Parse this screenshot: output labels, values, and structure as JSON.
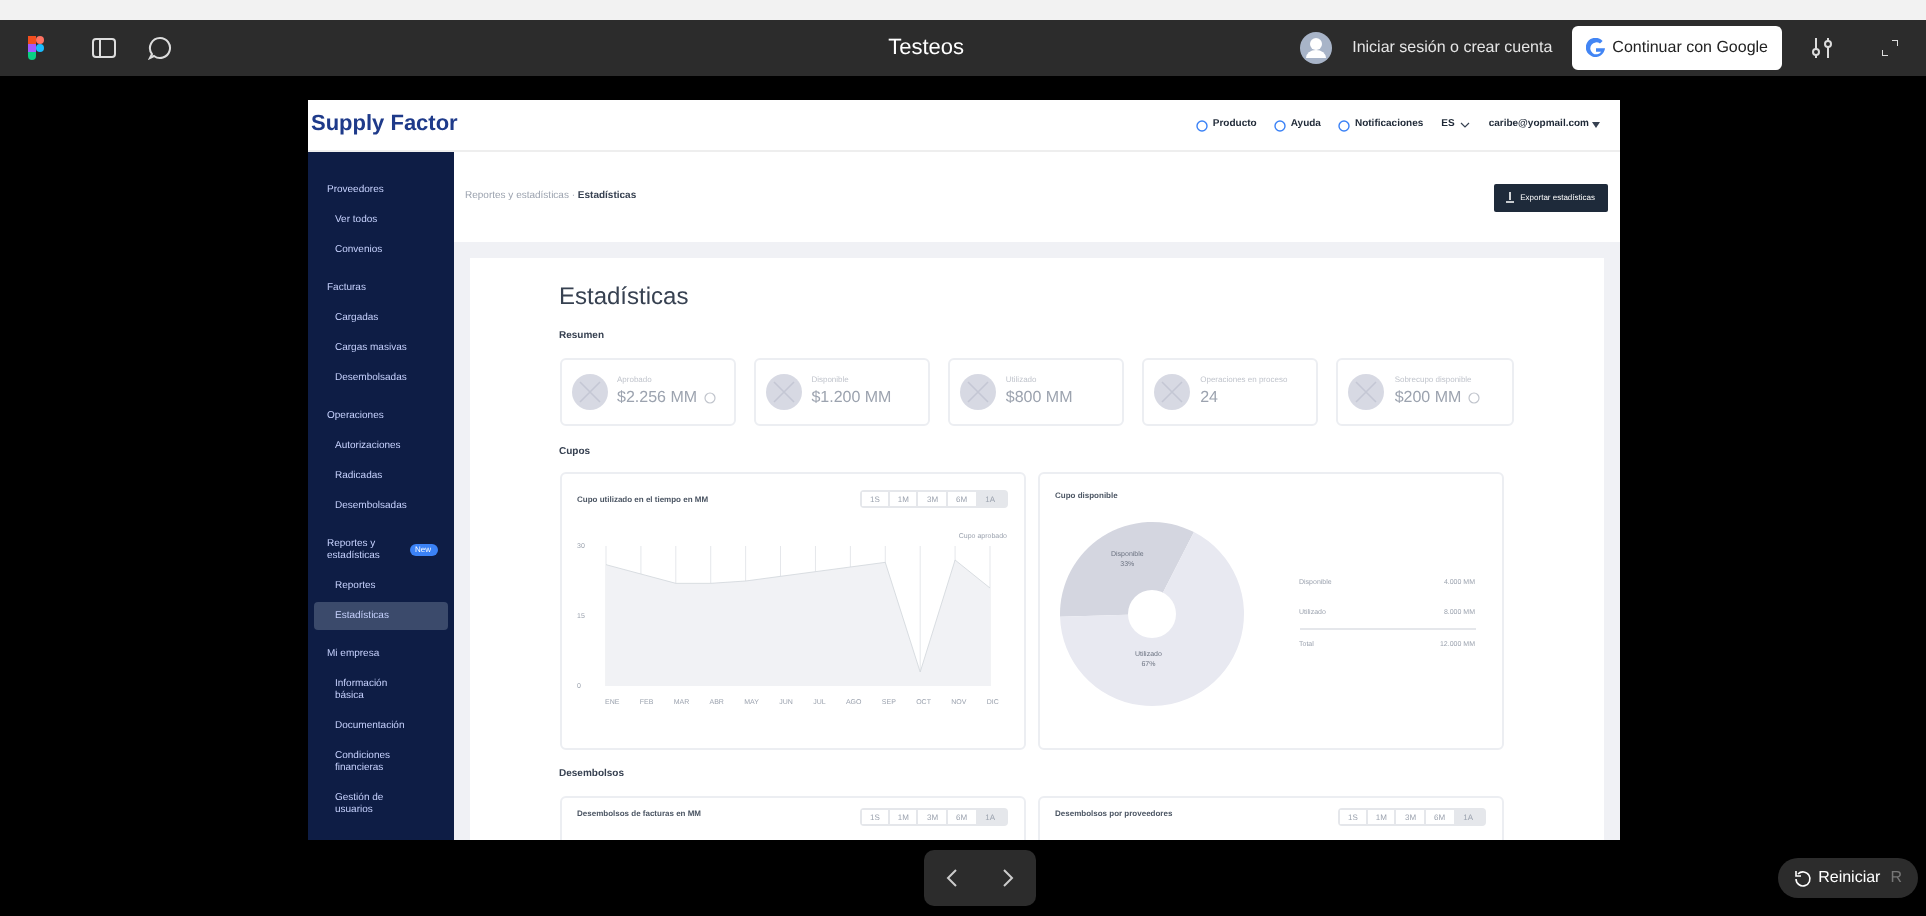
{
  "viewer": {
    "title": "Testeos",
    "login": "Iniciar sesión o crear cuenta",
    "google_button": "Continuar con Google",
    "restart": "Reiniciar",
    "restart_key": "R"
  },
  "app": {
    "logo": "Supply Factor",
    "nav": [
      "Producto",
      "Ayuda",
      "Notificaciones"
    ],
    "language": "ES",
    "user": "caribe@yopmail.com",
    "sidebar": [
      {
        "label": "Proveedores",
        "kind": "section",
        "selected": false
      },
      {
        "label": "Ver todos",
        "kind": "item",
        "selected": false
      },
      {
        "label": "Convenios",
        "kind": "item",
        "selected": false
      },
      {
        "label": "Facturas",
        "kind": "section",
        "selected": false
      },
      {
        "label": "Cargadas",
        "kind": "item",
        "selected": false
      },
      {
        "label": "Cargas masivas",
        "kind": "item",
        "selected": false
      },
      {
        "label": "Desembolsadas",
        "kind": "item",
        "selected": false
      },
      {
        "label": "Operaciones",
        "kind": "section",
        "selected": false
      },
      {
        "label": "Autorizaciones",
        "kind": "item",
        "selected": false
      },
      {
        "label": "Radicadas",
        "kind": "item",
        "selected": false
      },
      {
        "label": "Desembolsadas",
        "kind": "item",
        "selected": false
      },
      {
        "label": "Reportes y estadísticas",
        "kind": "section",
        "badge": "New",
        "selected": false
      },
      {
        "label": "Reportes",
        "kind": "item",
        "selected": false
      },
      {
        "label": "Estadísticas",
        "kind": "item",
        "selected": true
      },
      {
        "label": "Mi empresa",
        "kind": "section",
        "selected": false
      },
      {
        "label": "Información básica",
        "kind": "item",
        "selected": false
      },
      {
        "label": "Documentación",
        "kind": "item",
        "selected": false
      },
      {
        "label": "Condiciones financieras",
        "kind": "item",
        "selected": false
      },
      {
        "label": "Gestión de usuarios",
        "kind": "item",
        "selected": false
      }
    ],
    "breadcrumb": {
      "parent": "Reportes y estadísticas",
      "separator": "·",
      "current": "Estadísticas"
    },
    "export_button": "Exportar estadísticas",
    "title": "Estadísticas",
    "summary": {
      "heading": "Resumen",
      "cards": [
        {
          "label": "Aprobado",
          "value": "$2.256 MM",
          "info": true
        },
        {
          "label": "Disponible",
          "value": "$1.200 MM",
          "info": false
        },
        {
          "label": "Utilizado",
          "value": "$800 MM",
          "info": false
        },
        {
          "label": "Operaciones en proceso",
          "value": "24",
          "info": false
        },
        {
          "label": "Sobrecupo disponible",
          "value": "$200 MM",
          "info": true
        }
      ]
    },
    "cupos": {
      "heading": "Cupos",
      "line_chart": {
        "title": "Cupo utilizado en el tiempo en MM",
        "periods": [
          {
            "label": "1S",
            "selected": false
          },
          {
            "label": "1M",
            "selected": false
          },
          {
            "label": "3M",
            "selected": false
          },
          {
            "label": "6M",
            "selected": false
          },
          {
            "label": "1A",
            "selected": true
          }
        ],
        "chart_data": {
          "type": "area",
          "categories": [
            "ENE",
            "FEB",
            "MAR",
            "ABR",
            "MAY",
            "JUN",
            "JUL",
            "AGO",
            "SEP",
            "OCT",
            "NOV",
            "DIC"
          ],
          "ylim": [
            0,
            30
          ],
          "yticks": [
            0,
            15,
            30
          ],
          "grid": true,
          "series": [
            {
              "name": "Cupo aprobado",
              "color": "#d1d5db",
              "values": [
                26,
                24,
                22,
                22,
                22.5,
                23.5,
                24.5,
                25.5,
                26.5,
                3,
                27,
                21
              ]
            }
          ]
        }
      },
      "pie": {
        "title": "Cupo disponible",
        "slices": [
          {
            "label": "Disponible",
            "percent": "33%",
            "color": "#d4d6e0"
          },
          {
            "label": "Utilizado",
            "percent": "67%",
            "color": "#e8e9f1"
          }
        ],
        "legend": [
          {
            "label": "Disponible",
            "value": "4.000 MM"
          },
          {
            "label": "Utilizado",
            "value": "8.000 MM"
          },
          {
            "label": "Total",
            "value": "12.000 MM"
          }
        ]
      }
    },
    "desembolsos": {
      "heading": "Desembolsos",
      "cards": [
        {
          "title": "Desembolsos de facturas en MM",
          "periods": [
            {
              "label": "1S",
              "selected": false
            },
            {
              "label": "1M",
              "selected": false
            },
            {
              "label": "3M",
              "selected": false
            },
            {
              "label": "6M",
              "selected": false
            },
            {
              "label": "1A",
              "selected": true
            }
          ]
        },
        {
          "title": "Desembolsos por proveedores",
          "periods": [
            {
              "label": "1S",
              "selected": false
            },
            {
              "label": "1M",
              "selected": false
            },
            {
              "label": "3M",
              "selected": false
            },
            {
              "label": "6M",
              "selected": false
            },
            {
              "label": "1A",
              "selected": true
            }
          ]
        }
      ]
    }
  }
}
